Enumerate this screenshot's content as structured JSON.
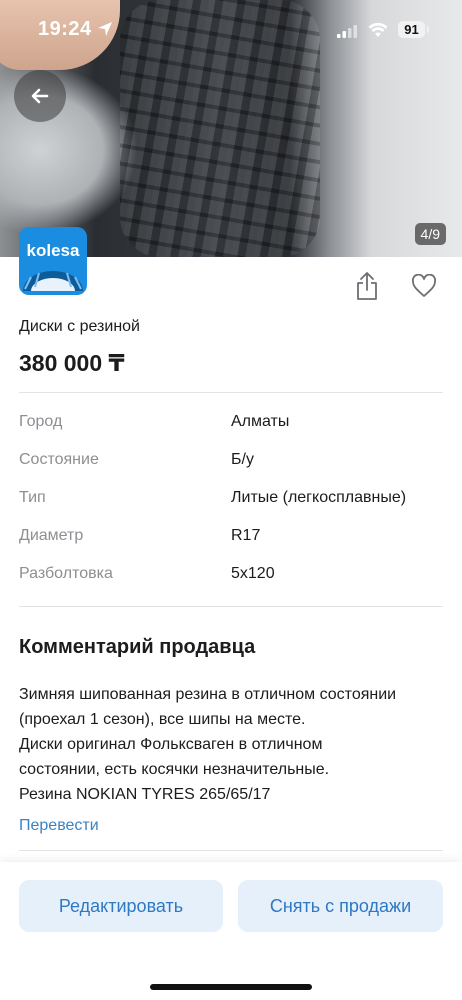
{
  "status_bar": {
    "time": "19:24",
    "battery": "91"
  },
  "photo": {
    "counter": "4/9"
  },
  "brand": {
    "logo_text": "kolesa"
  },
  "listing": {
    "title": "Диски с резиной",
    "price": "380 000 ₸"
  },
  "specs": [
    {
      "label": "Город",
      "value": "Алматы"
    },
    {
      "label": "Состояние",
      "value": "Б/у"
    },
    {
      "label": "Тип",
      "value": "Литые (легкосплавные)"
    },
    {
      "label": "Диаметр",
      "value": "R17"
    },
    {
      "label": "Разболтовка",
      "value": "5x120"
    }
  ],
  "comment": {
    "heading": "Комментарий продавца",
    "lines": [
      "Зимняя шипованная резина в отличном состоянии",
      "(проехал 1 сезон), все шипы на месте.",
      "Диски оригинал Фольксваген в отличном",
      "состоянии, есть косячки незначительные.",
      "Резина NOKIAN TYRES 265/65/17"
    ],
    "translate_label": "Перевести"
  },
  "actions": {
    "edit_label": "Редактировать",
    "remove_label": "Снять с продажи"
  },
  "icons": {
    "back": "arrow-left-icon",
    "share": "share-icon",
    "favorite": "heart-icon",
    "location": "location-arrow-icon",
    "signal": "signal-icon",
    "wifi": "wifi-icon"
  },
  "colors": {
    "accent": "#3b82c4",
    "button_bg": "#e5f0fb",
    "logo_bg": "#1a8de0",
    "label_gray": "#8e8e93"
  }
}
